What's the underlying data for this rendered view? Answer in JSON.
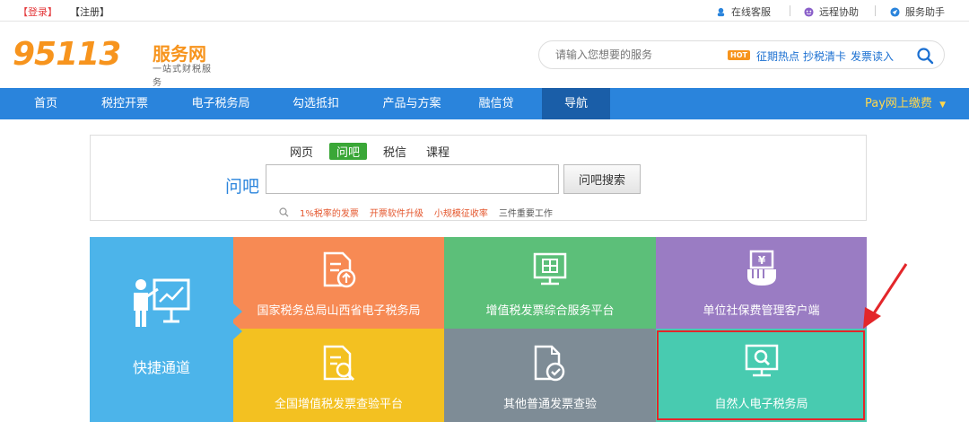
{
  "topbar": {
    "login": "【登录】",
    "register": "【注册】",
    "links": [
      {
        "label": "在线客服",
        "icon": "headset-icon"
      },
      {
        "label": "远程协助",
        "icon": "remote-assist-icon"
      },
      {
        "label": "服务助手",
        "icon": "service-helper-icon"
      }
    ]
  },
  "logo": {
    "number": "95113",
    "brand": "服务网",
    "slogan": "一站式财税服务"
  },
  "search": {
    "placeholder": "请输入您想要的服务",
    "hot_badge": "HOT",
    "quick_links": [
      "征期热点",
      "抄税清卡",
      "发票读入"
    ]
  },
  "nav": {
    "items": [
      "首页",
      "税控开票",
      "电子税务局",
      "勾选抵扣",
      "产品与方案",
      "融信贷",
      "导航"
    ],
    "active_index": 6,
    "pay": "Pay网上缴费"
  },
  "wenba": {
    "tabs": [
      "网页",
      "问吧",
      "税信",
      "课程"
    ],
    "active_tab": "问吧",
    "label": "问吧",
    "search_value": "",
    "button": "问吧搜索",
    "tags": [
      "1%税率的发票",
      "开票软件升级",
      "小规模征收率",
      "三件重要工作"
    ]
  },
  "tiles": {
    "quick": "快捷通道",
    "items": [
      {
        "label": "国家税务总局山西省电子税务局",
        "icon": "document-upload-icon",
        "color": "#f78a54"
      },
      {
        "label": "增值税发票综合服务平台",
        "icon": "monitor-tax-icon",
        "color": "#5cbf79"
      },
      {
        "label": "单位社保费管理客户端",
        "icon": "hand-yen-icon",
        "color": "#9a7cc3"
      },
      {
        "label": "全国增值税发票查验平台",
        "icon": "document-search-icon",
        "color": "#f3c121"
      },
      {
        "label": "其他普通发票查验",
        "icon": "document-check-icon",
        "color": "#7e8c96"
      },
      {
        "label": "自然人电子税务局",
        "icon": "monitor-search-icon",
        "color": "#48cbb0"
      }
    ],
    "quick_color": "#4cb4ea",
    "highlight_color": "#e3262a"
  }
}
